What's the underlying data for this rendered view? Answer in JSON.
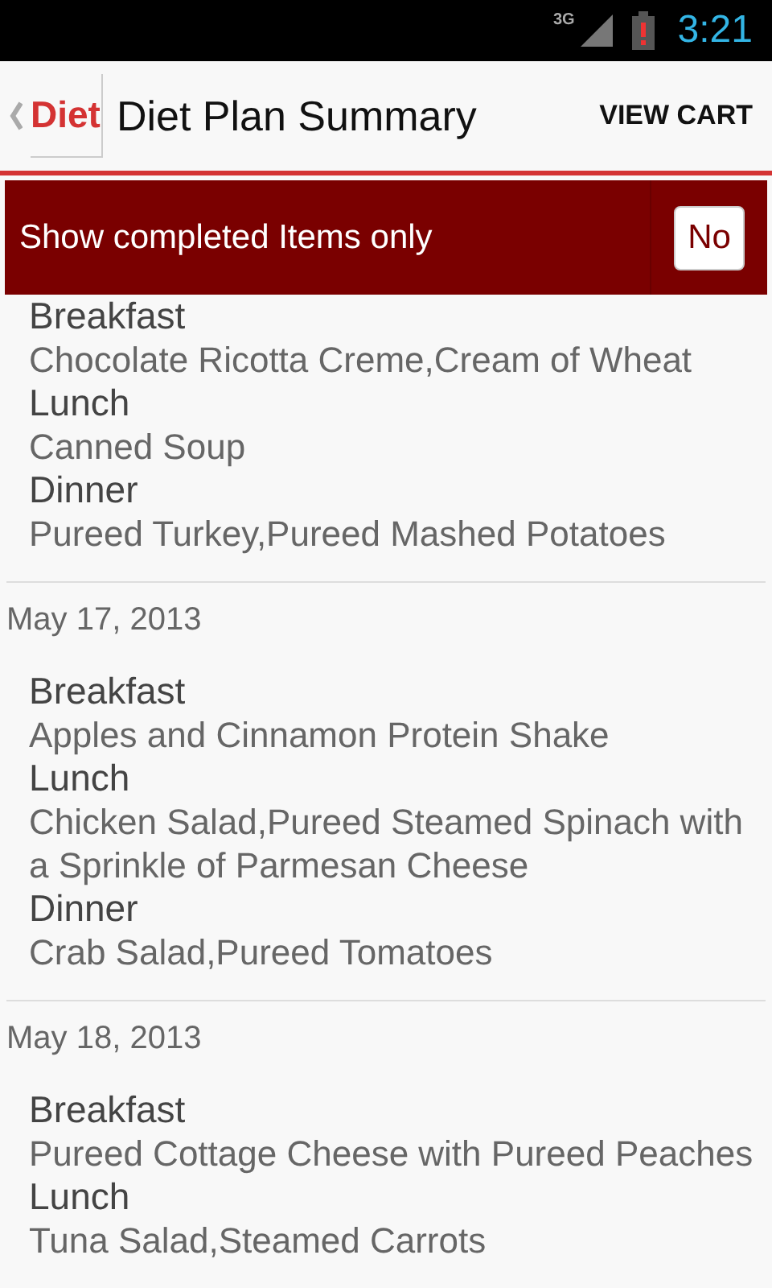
{
  "status_bar": {
    "network": "3G",
    "time": "3:21"
  },
  "action_bar": {
    "logo": "Diet",
    "title": "Diet Plan Summary",
    "action": "VIEW CART"
  },
  "filter": {
    "label": "Show completed Items only",
    "toggle": "No"
  },
  "days": [
    {
      "meals": [
        {
          "name": "Breakfast",
          "foods": "Chocolate Ricotta Creme,Cream of Wheat"
        },
        {
          "name": "Lunch",
          "foods": "Canned Soup"
        },
        {
          "name": "Dinner",
          "foods": "Pureed Turkey,Pureed Mashed Potatoes"
        }
      ]
    },
    {
      "date": "May 17, 2013",
      "meals": [
        {
          "name": "Breakfast",
          "foods": "Apples and Cinnamon Protein Shake"
        },
        {
          "name": "Lunch",
          "foods": "Chicken Salad,Pureed Steamed Spinach with a Sprinkle of Parmesan Cheese"
        },
        {
          "name": "Dinner",
          "foods": "Crab Salad,Pureed Tomatoes"
        }
      ]
    },
    {
      "date": "May 18, 2013",
      "meals": [
        {
          "name": "Breakfast",
          "foods": "Pureed Cottage Cheese with Pureed Peaches"
        },
        {
          "name": "Lunch",
          "foods": "Tuna Salad,Steamed Carrots"
        }
      ]
    }
  ]
}
